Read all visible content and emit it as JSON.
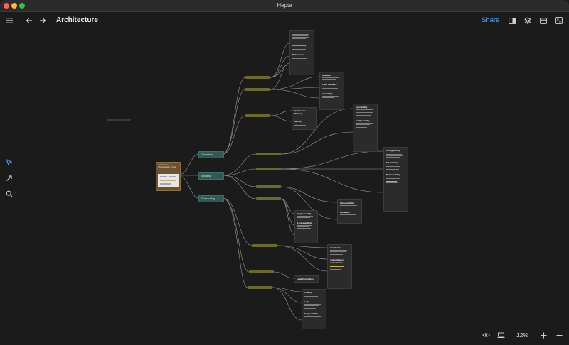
{
  "window": {
    "title": "Hepta"
  },
  "toolbar": {
    "document_title": "Architecture",
    "share_label": "Share",
    "icons": [
      "menu-icon",
      "back-arrow-icon",
      "forward-arrow-icon",
      "sidebar-panel-icon",
      "layers-icon",
      "calendar-icon",
      "settings-panel-icon"
    ]
  },
  "left_tools": [
    "select-pointer-icon",
    "connector-arrow-icon",
    "search-icon"
  ],
  "bottom_bar": {
    "zoom_level": "12%",
    "icons": [
      "eye-icon",
      "presentation-icon",
      "zoom-in-icon",
      "zoom-out-icon"
    ]
  },
  "mindmap": {
    "root": {
      "title": "Architecture Characteristic Types"
    },
    "main_nodes": [
      {
        "label": "Operational"
      },
      {
        "label": "Structural"
      },
      {
        "label": "Cross-cutting"
      }
    ],
    "cards": [
      {
        "titles": [
          "",
          "Recoverability",
          "Robustness"
        ]
      },
      {
        "titles": [
          "Reliability",
          "Fault Tolerance",
          "Availability"
        ]
      },
      {
        "titles": [
          "Continuous Delivery",
          "Security"
        ]
      },
      {
        "titles": [
          "Extensibility",
          "Configurability"
        ]
      },
      {
        "titles": [
          "Configurability",
          "Extensibility",
          "Maintainability"
        ]
      },
      {
        "titles": [
          "Interoperability",
          "Portability"
        ]
      },
      {
        "titles": [
          "Localization",
          "Authentication Authorization"
        ]
      },
      {
        "titles": [
          "Upgradeability",
          "Leverageability"
        ]
      },
      {
        "titles": [
          "Legal Constraints"
        ]
      },
      {
        "titles": [
          "Privacy",
          "Legal",
          "Supportability"
        ]
      }
    ]
  }
}
